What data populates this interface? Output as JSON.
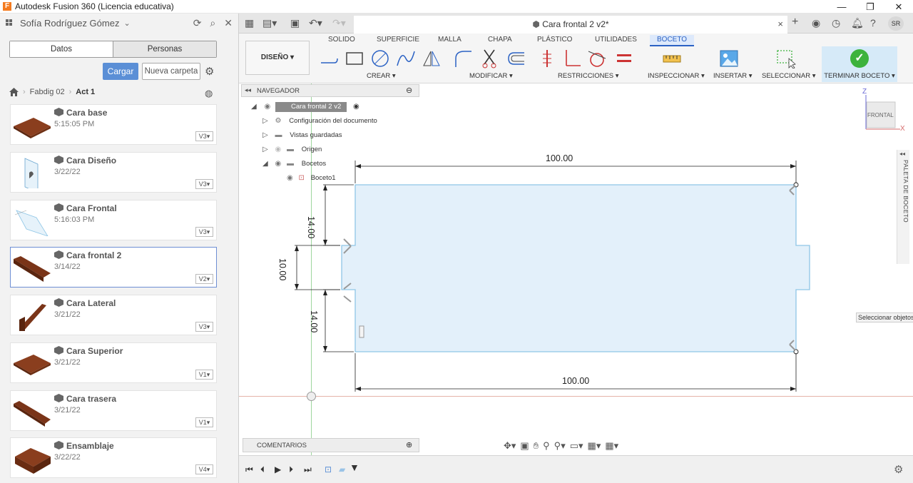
{
  "window": {
    "title": "Autodesk Fusion 360 (Licencia educativa)",
    "logo": "F",
    "controls": [
      "—",
      "❐",
      "✕"
    ]
  },
  "data_panel": {
    "user": "Sofía Rodríguez Gómez",
    "tabs": [
      "Datos",
      "Personas"
    ],
    "upload_label": "Cargar",
    "new_folder_label": "Nueva carpeta",
    "breadcrumb": [
      "Fabdig 02",
      "Act 1"
    ],
    "items": [
      {
        "name": "Cara base",
        "date": "5:15:05 PM",
        "version": "V3"
      },
      {
        "name": "Cara Diseño",
        "date": "3/22/22",
        "version": "V3"
      },
      {
        "name": "Cara Frontal",
        "date": "5:16:03 PM",
        "version": "V3"
      },
      {
        "name": "Cara frontal 2",
        "date": "3/14/22",
        "version": "V2"
      },
      {
        "name": "Cara Lateral",
        "date": "3/21/22",
        "version": "V3"
      },
      {
        "name": "Cara Superior",
        "date": "3/21/22",
        "version": "V1"
      },
      {
        "name": "Cara trasera",
        "date": "3/21/22",
        "version": "V1"
      },
      {
        "name": "Ensamblaje",
        "date": "3/22/22",
        "version": "V4"
      }
    ]
  },
  "document_tab": {
    "title": "Cara frontal 2 v2*",
    "close": "×"
  },
  "ribbon": {
    "workspace": "DISEÑO ▾",
    "tabs": [
      "SOLIDO",
      "SUPERFICIE",
      "MALLA",
      "CHAPA",
      "PLÁSTICO",
      "UTILIDADES",
      "BOCETO"
    ],
    "groups": {
      "create": "CREAR ▾",
      "modify": "MODIFICAR ▾",
      "constraints": "RESTRICCIONES ▾",
      "inspect": "INSPECCIONAR ▾",
      "insert": "INSERTAR ▾",
      "select": "SELECCIONAR ▾",
      "finish": "TERMINAR BOCETO ▾"
    }
  },
  "navigator": {
    "title": "NAVEGADOR",
    "root": "Cara frontal 2 v2",
    "nodes": [
      "Configuración del documento",
      "Vistas guardadas",
      "Origen",
      "Bocetos"
    ],
    "sketch": "Boceto1"
  },
  "sketch": {
    "dimensions": {
      "top": "100.00",
      "bottom": "100.00",
      "left_upper": "14.00",
      "left_middle": "10.00",
      "left_lower": "14.00"
    },
    "colors": {
      "fill": "#e3f0fa",
      "edge": "#8fc6e6",
      "dim": "#222222"
    }
  },
  "viewcube": {
    "face": "FRONTAL",
    "axis_z": "Z",
    "axis_x": "X"
  },
  "palette_label": "PALETA DE BOCETO",
  "tooltip": "Seleccionar objetos o",
  "comments": "COMENTARIOS",
  "accent_color": "#2b62c4"
}
